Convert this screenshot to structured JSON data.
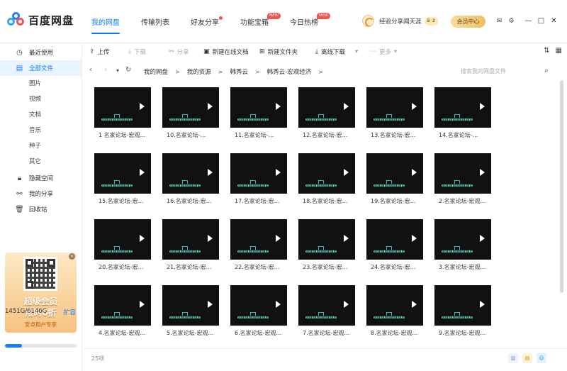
{
  "app": {
    "logo_text": "百度网盘"
  },
  "nav": {
    "items": [
      {
        "label": "我的网盘",
        "active": true,
        "badge": ""
      },
      {
        "label": "传输列表",
        "active": false,
        "badge": ""
      },
      {
        "label": "好友分享",
        "active": false,
        "badge": "dot"
      },
      {
        "label": "功能宝箱",
        "active": false,
        "badge": "NEW"
      },
      {
        "label": "今日热榜",
        "active": false,
        "badge": "NEW"
      }
    ]
  },
  "user": {
    "name": "经验分享闻天涯",
    "level_left": "5",
    "level_right": "2",
    "vip_button": "会员中心"
  },
  "icons": {
    "mail": "mail-icon",
    "settings": "gear-icon",
    "win_min": "—",
    "win_max": "□",
    "win_close": "✕"
  },
  "sidebar": {
    "items": [
      {
        "label": "最近使用",
        "icon": "clock-icon",
        "glyph": "◷"
      },
      {
        "label": "全部文件",
        "icon": "file-icon",
        "glyph": "▤"
      },
      {
        "label": "隐藏空间",
        "icon": "lock-icon",
        "glyph": "🔒︎"
      },
      {
        "label": "我的分享",
        "icon": "share-icon",
        "glyph": "⚯"
      },
      {
        "label": "回收站",
        "icon": "trash-icon",
        "glyph": "🗑︎"
      }
    ],
    "subitems": [
      "图片",
      "视频",
      "文档",
      "音乐",
      "种子",
      "其它"
    ]
  },
  "promo": {
    "title1": "超级会员",
    "title2": "限时6折",
    "subtitle": "安卓用户专享",
    "close": "✕"
  },
  "quota": {
    "text": "1451G/6146G",
    "used_fraction": 0.236,
    "expand": "扩容"
  },
  "toolbar": {
    "upload": "上传",
    "download": "下载",
    "share": "分享",
    "new_online_doc": "新建在线文档",
    "new_folder": "新建文件夹",
    "offline_download": "离线下载",
    "more": "更多"
  },
  "path": {
    "back": "‹",
    "forward": "›",
    "crumbs": [
      "我的网盘",
      "我的资源",
      "韩秀云",
      "韩秀云-宏观经济"
    ],
    "search_placeholder": "搜索我的网盘文件"
  },
  "files": [
    "1 名家论坛-宏观...",
    "10.名家论坛-...",
    "11.名家论坛-...",
    "12.名家论坛-宏...",
    "13.名家论坛-宏...",
    "14.名家论坛-...",
    "15.名家论坛-宏...",
    "16.名家论坛-宏...",
    "17.名家论坛-宏...",
    "18.名家论坛-宏...",
    "19.名家论坛-宏...",
    "2.名家论坛-宏观...",
    "20.名家论坛-宏...",
    "21.名家论坛-宏...",
    "22.名家论坛-宏...",
    "23.名家论坛-宏...",
    "24.名家论坛-宏...",
    "3.名家论坛-宏观...",
    "4.名家论坛-宏观...",
    "5.名家论坛-宏观...",
    "6.名家论坛-宏观...",
    "7.名家论坛-宏观...",
    "8.名家论坛-宏观...",
    "9.名家论坛-宏观..."
  ],
  "footer": {
    "count": "25项"
  },
  "colors": {
    "accent": "#0a7aff",
    "badge_red": "#f5524a",
    "vip_gold": "#efbf62"
  }
}
